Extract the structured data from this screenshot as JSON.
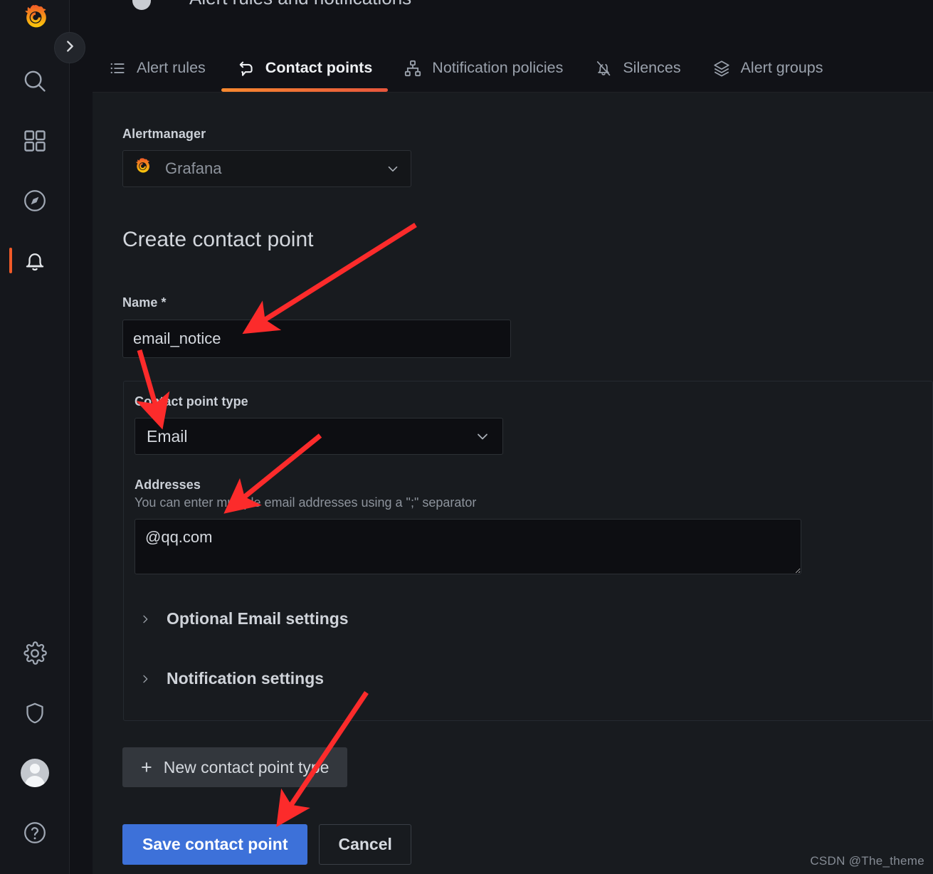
{
  "header": {
    "title": "Alert rules and notifications"
  },
  "nav": {
    "logo_icon": "grafana-logo-icon",
    "collapse_icon": "chevron-right-icon",
    "items": [
      {
        "name": "search",
        "icon": "search-icon",
        "active": false
      },
      {
        "name": "dashboards",
        "icon": "dashboards-grid-icon",
        "active": false
      },
      {
        "name": "explore",
        "icon": "compass-icon",
        "active": false
      },
      {
        "name": "alerting",
        "icon": "bell-icon",
        "active": true
      },
      {
        "name": "configuration",
        "icon": "gear-icon",
        "active": false
      },
      {
        "name": "server-admin",
        "icon": "shield-icon",
        "active": false
      },
      {
        "name": "profile",
        "icon": "user-avatar-icon",
        "active": false
      },
      {
        "name": "help",
        "icon": "question-circle-icon",
        "active": false
      }
    ]
  },
  "tabs": [
    {
      "label": "Alert rules",
      "icon": "list-icon",
      "active": false
    },
    {
      "label": "Contact points",
      "icon": "comment-share-icon",
      "active": true
    },
    {
      "label": "Notification policies",
      "icon": "sitemap-icon",
      "active": false
    },
    {
      "label": "Silences",
      "icon": "bell-slash-icon",
      "active": false
    },
    {
      "label": "Alert groups",
      "icon": "layers-icon",
      "active": false
    }
  ],
  "form": {
    "alertmanager_label": "Alertmanager",
    "alertmanager_value": "Grafana",
    "alertmanager_icon": "grafana-logo-icon",
    "page_title": "Create contact point",
    "name_label": "Name *",
    "name_value": "email_notice",
    "contact_point_type_label": "Contact point type",
    "contact_point_type_value": "Email",
    "addresses_label": "Addresses",
    "addresses_description": "You can enter multiple email addresses using a \";\" separator",
    "addresses_value": "@qq.com",
    "optional_settings_label": "Optional Email settings",
    "notification_settings_label": "Notification settings",
    "new_contact_point_type_label": "New contact point type",
    "save_label": "Save contact point",
    "cancel_label": "Cancel"
  },
  "watermark": "CSDN @The_theme",
  "colors": {
    "accent_orange": "#f05a28",
    "tab_underline_from": "#f7882f",
    "tab_underline_to": "#e8563c",
    "primary_button": "#3d71d9",
    "annotation_arrow": "#fc2b2b",
    "page_bg": "#111217",
    "panel_bg": "#181b1f",
    "input_bg": "#0d0e12"
  }
}
